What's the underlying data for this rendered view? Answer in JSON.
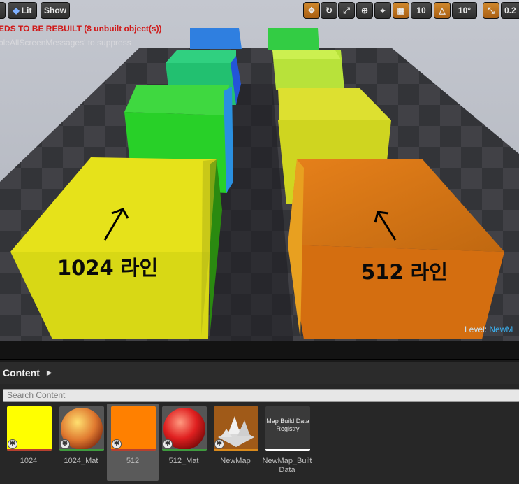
{
  "toolbar": {
    "lit_label": "Lit",
    "show_label": "Show",
    "grid_snap_value": "10",
    "rotation_snap_value": "10°",
    "scale_snap_value": "0.2"
  },
  "viewport": {
    "warning_text": "EDS TO BE REBUILT (8 unbuilt object(s))",
    "suppress_text": "bleAllScreenMessages' to suppress",
    "level_label": "Level:",
    "level_name": "NewM",
    "annotations": {
      "left_label": "1024 라인",
      "right_label": "512 라인"
    }
  },
  "content_browser": {
    "title": "Content",
    "search_placeholder": "Search Content",
    "assets": [
      {
        "label": "1024",
        "kind": "texture",
        "color": "#ffff00",
        "bar": "#b73f2f"
      },
      {
        "label": "1024_Mat",
        "kind": "material",
        "color": "#e0a040",
        "bar": "#3e9a3e"
      },
      {
        "label": "512",
        "kind": "texture",
        "color": "#ff8000",
        "bar": "#b73f2f",
        "selected": true
      },
      {
        "label": "512_Mat",
        "kind": "material",
        "color": "#e02020",
        "bar": "#3e9a3e"
      },
      {
        "label": "NewMap",
        "kind": "map",
        "color": "#a05a18",
        "bar": "#d98a1c"
      },
      {
        "label": "NewMap_Built Data",
        "kind": "registry",
        "color": "#3a3a3a",
        "bar": "#ffffff",
        "thumb_text": "Map Build Data Registry"
      }
    ]
  },
  "colors": {
    "warning": "#d01818",
    "accent": "#d0882c",
    "level_name": "#3ab0f0"
  }
}
